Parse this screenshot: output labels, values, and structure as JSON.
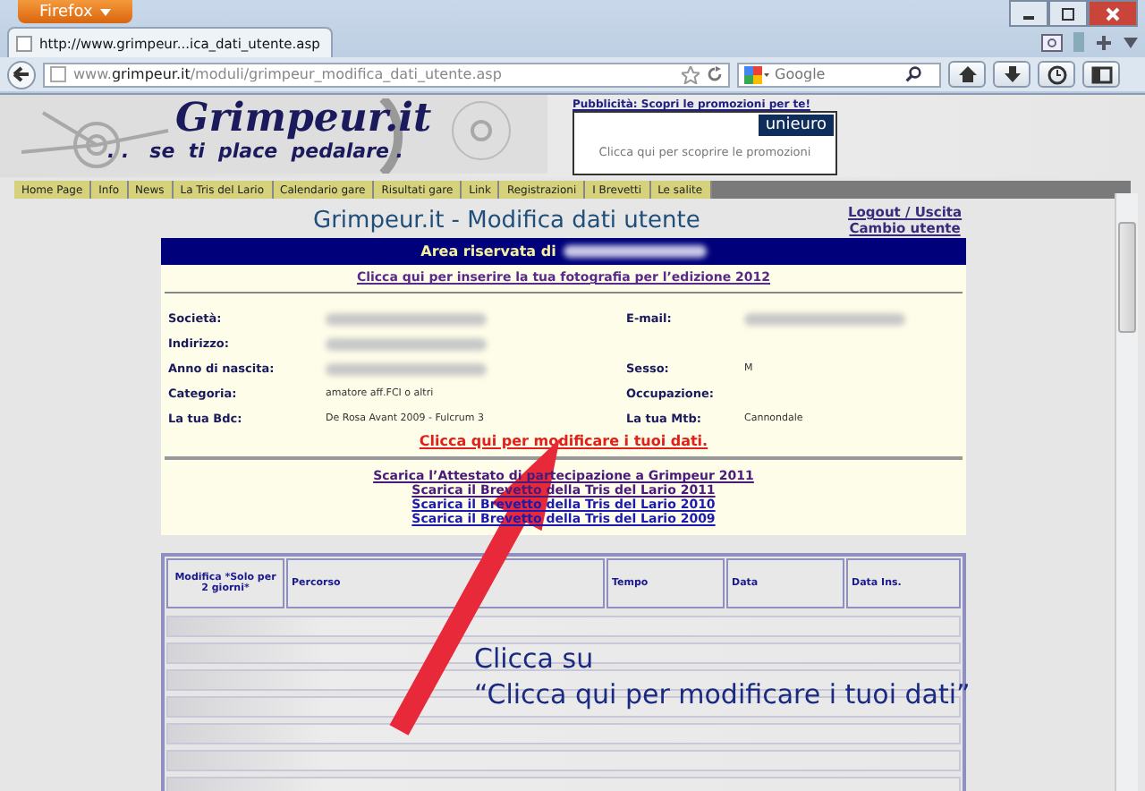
{
  "browser": {
    "app_button": "Firefox",
    "tab_title": "http://www.grimpeur...ica_dati_utente.asp",
    "url": "www.**grimpeur.it**/moduli/grimpeur_modifica_dati_utente.asp",
    "search_placeholder": "Google"
  },
  "site": {
    "logo": "Grimpeur.it",
    "tagline": ". .   se  ti  place  pedalare .",
    "ad_label": "Pubblicità: Scopri le promozioni per te!",
    "ad_brand": "unieuro",
    "ad_text": "Clicca qui per scoprire le promozioni",
    "menu": [
      "Home Page",
      "Info",
      "News",
      "La Tris del Lario",
      "Calendario gare",
      "Risultati gare",
      "Link",
      "Registrazioni",
      "I Brevetti",
      "Le salite"
    ]
  },
  "page": {
    "title": "Grimpeur.it - Modifica dati utente",
    "user_links": [
      "Logout / Uscita",
      "Cambio utente"
    ]
  },
  "panel": {
    "header": "Area riservata di",
    "header_redacted": true,
    "photo_link": "Clicca qui per inserire la tua fotografia per l’edizione 2012",
    "rows": [
      {
        "label": "Società:",
        "redacted": true,
        "label_2": "E-mail:",
        "redacted_2": true
      },
      {
        "label": "Indirizzo:",
        "redacted": true
      },
      {
        "label": "Anno di nascita:",
        "redacted": true,
        "label_2": "Sesso:",
        "value_2": "M"
      },
      {
        "label": "Categoria:",
        "value": "amatore aff.FCI o altri",
        "label_2": "Occupazione:"
      },
      {
        "label": "La tua Bdc:",
        "value": "De Rosa Avant 2009 - Fulcrum 3",
        "label_2": "La tua Mtb:",
        "value_2": "Cannondale"
      }
    ],
    "edit_link": "Clicca qui per modificare i tuoi dati.",
    "downloads": [
      {
        "label": "Scarica l’Attestato di partecipazione a Grimpeur 2011",
        "visited": true
      },
      {
        "label": "Scarica il Brevetto della Tris del Lario 2011",
        "visited": true
      },
      {
        "label": "Scarica il Brevetto della Tris del Lario 2010",
        "visited": false
      },
      {
        "label": "Scarica il Brevetto della Tris del Lario 2009",
        "visited": false
      }
    ]
  },
  "table": {
    "columns": [
      "Modifica *Solo per 2 giorni*",
      "Percorso",
      "Tempo",
      "Data",
      "Data Ins."
    ]
  },
  "annotation": {
    "lines": [
      "Clicca su",
      "“Clicca qui per modificare i tuoi dati”"
    ]
  }
}
